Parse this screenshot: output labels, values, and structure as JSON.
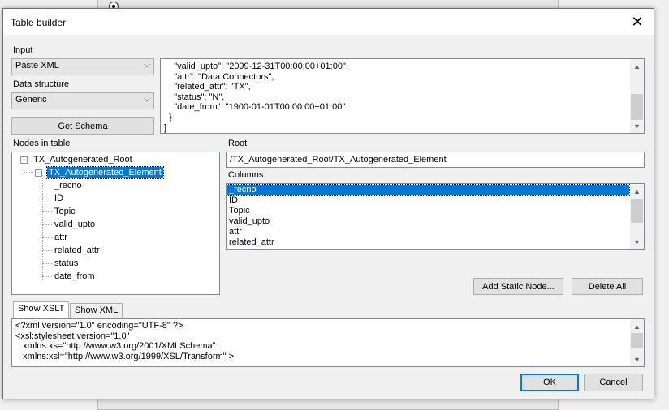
{
  "dialog": {
    "title": "Table builder",
    "close_glyph": "✕"
  },
  "input": {
    "label": "Input",
    "value": "Paste XML",
    "data_structure_label": "Data structure",
    "data_structure_value": "Generic",
    "get_schema_label": "Get Schema"
  },
  "source_text": {
    "lines": [
      "    \"valid_upto\": \"2099-12-31T00:00:00+01:00\",",
      "    \"attr\": \"Data Connectors\",",
      "    \"related_attr\": \"TX\",",
      "    \"status\": \"N\",",
      "    \"date_from\": \"1900-01-01T00:00:00+01:00\"",
      "  }",
      "]"
    ]
  },
  "nodes": {
    "label": "Nodes in table",
    "root": "TX_Autogenerated_Root",
    "element": "TX_Autogenerated_Element",
    "children": [
      "_recno",
      "ID",
      "Topic",
      "valid_upto",
      "attr",
      "related_attr",
      "status",
      "date_from"
    ]
  },
  "root": {
    "label": "Root",
    "value": "/TX_Autogenerated_Root/TX_Autogenerated_Element"
  },
  "columns": {
    "label": "Columns",
    "items": [
      "_recno",
      "ID",
      "Topic",
      "valid_upto",
      "attr",
      "related_attr"
    ],
    "selected_index": 0
  },
  "buttons": {
    "add_static_node": "Add Static Node...",
    "delete_all": "Delete All",
    "ok": "OK",
    "cancel": "Cancel"
  },
  "tabs": {
    "show_xslt": "Show XSLT",
    "show_xml": "Show XML"
  },
  "xslt_text": {
    "lines": [
      "<?xml version=\"1.0\" encoding=\"UTF-8\" ?>",
      "<xsl:stylesheet version=\"1.0\"",
      "   xmlns:xs=\"http://www.w3.org/2001/XMLSchema\"",
      "   xmlns:xsl=\"http://www.w3.org/1999/XSL/Transform\" >"
    ]
  },
  "colors": {
    "accent": "#0078d7",
    "dialog_bg": "#f0f0f0"
  },
  "icons": {
    "combo_arrow": "chevron-down-icon",
    "scroll_up": "chevron-up-icon",
    "scroll_down": "chevron-down-icon",
    "tree_expander": "minus-box-icon"
  }
}
